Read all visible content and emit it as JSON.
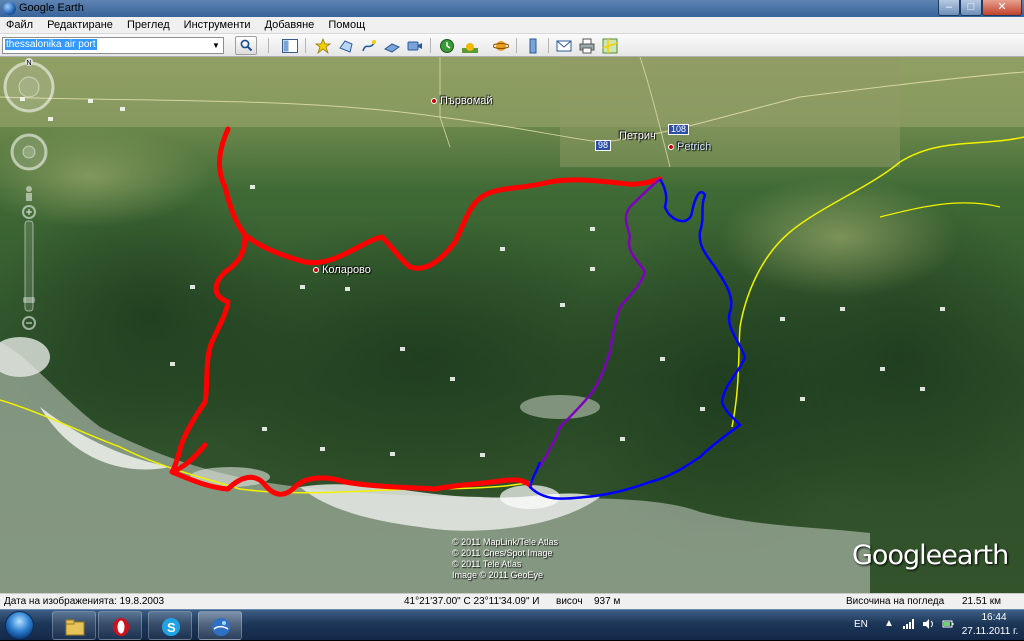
{
  "window": {
    "title": "Google Earth",
    "controls": {
      "minimize": "–",
      "maximize": "□",
      "close": "✕"
    }
  },
  "menu": {
    "items": [
      "Файл",
      "Редактиране",
      "Преглед",
      "Инструменти",
      "Добавяне",
      "Помощ"
    ]
  },
  "search": {
    "value": "thessalonika air port",
    "button_icon": "search-icon"
  },
  "toolbar": {
    "icons": [
      "sidebar-icon",
      "placemark-icon",
      "polygon-icon",
      "path-icon",
      "image-overlay-icon",
      "record-tour-icon",
      "historical-imagery-icon",
      "sunlight-icon",
      "planet-icon",
      "ruler-icon",
      "email-icon",
      "print-icon",
      "google-maps-icon"
    ]
  },
  "map": {
    "places": {
      "parvomay": "Първомай",
      "petrich": "Петрич",
      "petrich_latin": "Petrich",
      "kolarovo": "Коларово"
    },
    "road_shields": {
      "r98": "98",
      "r108": "108"
    },
    "copyright": [
      "© 2011 MapLink/Tele Atlas",
      "© 2011 Cnes/Spot Image",
      "© 2011 Tele Atlas",
      "Image © 2011 GeoEye"
    ],
    "logo": {
      "part1": "Google",
      "part2": "earth"
    },
    "route_colors": {
      "red": "#ff0000",
      "blue": "#0000ff",
      "purple": "#8000c0",
      "border": "#f2f200"
    }
  },
  "status": {
    "image_date": "Дата на изображенията: 19.8.2003",
    "coords": "41°21'37.00\" С  23°11'34.09\" И",
    "elevation_label": "височ",
    "elevation_value": "937 м",
    "eye_alt_label": "Височина на погледа",
    "eye_alt_value": "21.51 км"
  },
  "taskbar": {
    "apps": [
      "windows-explorer-icon",
      "opera-icon",
      "skype-icon",
      "google-earth-icon"
    ],
    "language": "EN",
    "time": "16:44",
    "date": "27.11.2011 г."
  }
}
